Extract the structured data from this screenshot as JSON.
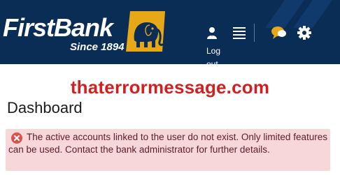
{
  "header": {
    "brand": "FirstBank",
    "tagline": "Since 1894",
    "logout_label": "Log out",
    "icons": [
      "user-icon",
      "menu-icon",
      "chat-icon",
      "gear-icon"
    ]
  },
  "watermark": "thaterrormessage.com",
  "page": {
    "title": "Dashboard"
  },
  "alert": {
    "icon": "error-circle-icon",
    "message": "The active accounts linked to the user do not exist. Only limited features can be used. Contact the bank administrator for further details."
  },
  "colors": {
    "header_bg": "#0a2d56",
    "logo_gold": "#e6a817",
    "alert_bg": "#f8d7da",
    "alert_icon": "#d9534f",
    "watermark": "#d21f1f"
  }
}
